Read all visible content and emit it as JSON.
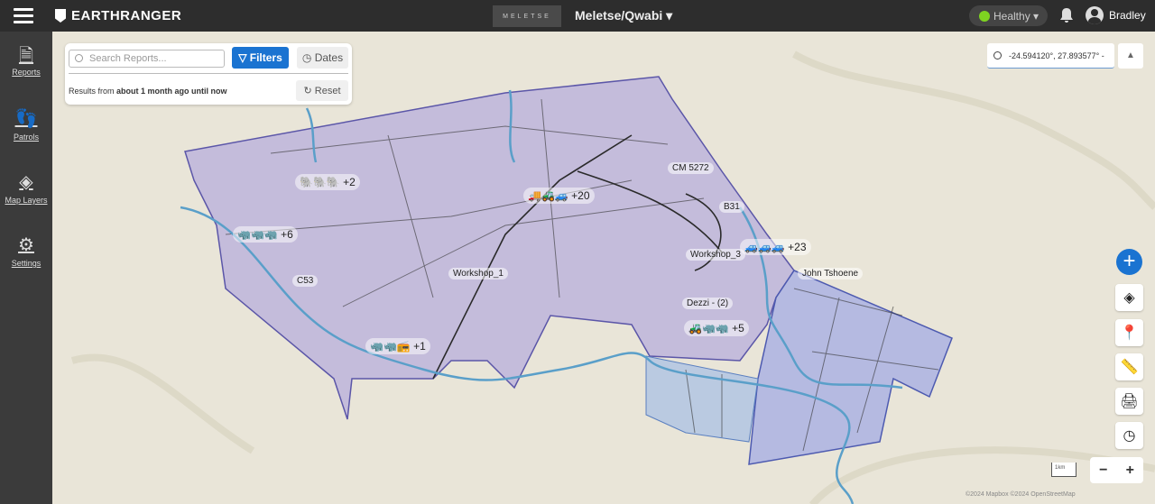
{
  "header": {
    "brand": "EARTHRANGER",
    "site_logo_text": "MELETSE",
    "site_selector": "Meletse/Qwabi ▾",
    "health": "Healthy ▾",
    "health_color": "#7ed321",
    "user": "Bradley"
  },
  "sidebar": {
    "items": [
      {
        "label": "Reports",
        "icon": "document-icon"
      },
      {
        "label": "Patrols",
        "icon": "patrol-icon"
      },
      {
        "label": "Map Layers",
        "icon": "layers-icon"
      },
      {
        "label": "Settings",
        "icon": "gear-icon"
      }
    ]
  },
  "reports_panel": {
    "search_placeholder": "Search Reports...",
    "filters": "Filters",
    "dates": "Dates",
    "results_prefix": "Results from ",
    "results_range": "about 1 month ago until now",
    "reset": "Reset",
    "accent": "#1a73d1"
  },
  "coordinates": "-24.594120°, 27.893577° -",
  "map_labels": {
    "workshop1": "Workshop_1",
    "workshop3": "Workshop_3",
    "cm5272": "CM 5272",
    "b31": "B31",
    "c53": "C53",
    "john": "John Tshoene",
    "dezzi": "Dezzi - (2)"
  },
  "clusters": {
    "c1": "+2",
    "c2": "+6",
    "c3": "+20",
    "c4": "+23",
    "c5": "+5",
    "c6": "+1"
  },
  "zoom": {
    "minus": "−",
    "plus": "+"
  },
  "scale": "1km",
  "attribution": "©2024 Mapbox ©2024 OpenStreetMap",
  "colors": {
    "main_area": "#b7aedc",
    "east_area": "#9ea8e6",
    "south_area": "#a9c0e4",
    "rivers": "#5a9fc9"
  }
}
